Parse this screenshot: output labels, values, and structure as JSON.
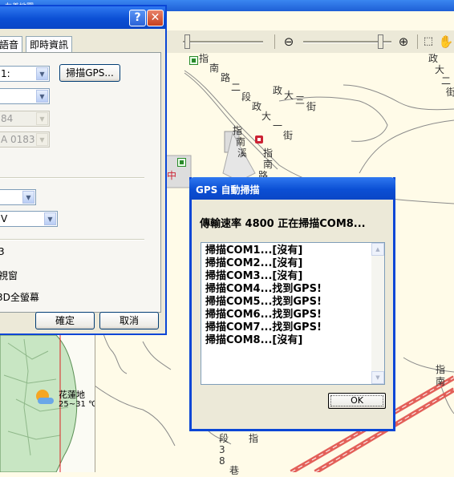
{
  "app": {
    "window_title": "友善地圖..."
  },
  "map": {
    "labels": [
      {
        "text": "指"
      },
      {
        "text": "南"
      },
      {
        "text": "路"
      },
      {
        "text": "二"
      },
      {
        "text": "段"
      },
      {
        "text": "政"
      },
      {
        "text": "大"
      },
      {
        "text": "三"
      },
      {
        "text": "街"
      },
      {
        "text": "政"
      },
      {
        "text": "大"
      },
      {
        "text": "一"
      },
      {
        "text": "街"
      },
      {
        "text": "政"
      },
      {
        "text": "大"
      },
      {
        "text": "二"
      },
      {
        "text": "街"
      },
      {
        "text": "指"
      },
      {
        "text": "南"
      },
      {
        "text": "溪"
      },
      {
        "text": "指"
      },
      {
        "text": "南"
      },
      {
        "text": "路"
      },
      {
        "text": "指南"
      },
      {
        "text": "段"
      },
      {
        "text": "3"
      },
      {
        "text": "8"
      },
      {
        "text": "巷"
      },
      {
        "text": "指"
      },
      {
        "text": "中"
      }
    ]
  },
  "settings": {
    "tabs": [
      "語音",
      "即時資訊"
    ],
    "combo_port": "1:",
    "combo_2": "",
    "combo_3_disabled": "84",
    "combo_4_disabled": "A 0183",
    "scan_button": "掃描GPS...",
    "combo_5": "",
    "combo_6": "V",
    "option_1": "3",
    "option_2": "視窗",
    "option_3": "3D全螢幕",
    "ok_button": "確定",
    "cancel_button": "取消"
  },
  "mini_map": {
    "weather_place": "花蓮地",
    "weather_temp": "25~31 ℃"
  },
  "gps_dialog": {
    "title": "GPS 自動掃描",
    "status": "傳輸速率 4800 正在掃描COM8...",
    "log": [
      "掃描COM1...[沒有]",
      "掃描COM2...[沒有]",
      "掃描COM3...[沒有]",
      "掃描COM4...找到GPS!",
      "掃描COM5...找到GPS!",
      "掃描COM6...找到GPS!",
      "掃描COM7...找到GPS!",
      "掃描COM8...[沒有]"
    ],
    "ok_button": "OK"
  },
  "colors": {
    "title_blue": "#0a46d6",
    "road_red": "#e0504a",
    "map_bg": "#fffbe8"
  }
}
